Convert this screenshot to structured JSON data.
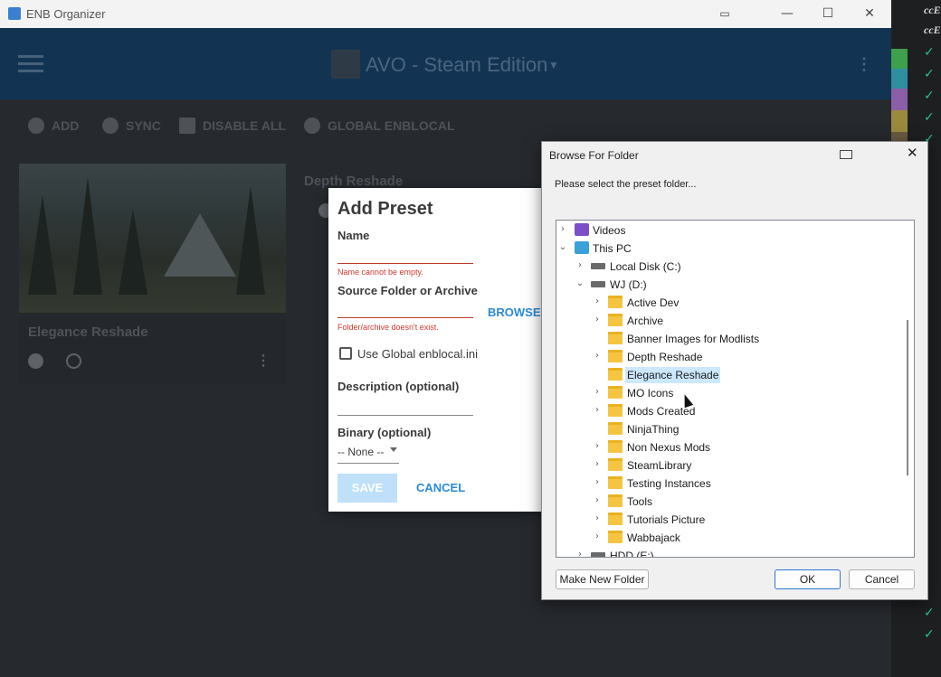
{
  "app": {
    "title": "ENB Organizer",
    "profile_title": "AVO - Steam Edition"
  },
  "toolbar": {
    "add": "ADD",
    "sync": "SYNC",
    "disable_all": "DISABLE ALL",
    "global_enblocal": "GLOBAL ENBLOCAL"
  },
  "presets": [
    {
      "name": "Elegance Reshade"
    },
    {
      "name": "Depth Reshade"
    }
  ],
  "add_preset": {
    "title": "Add Preset",
    "name_label": "Name",
    "name_error": "Name cannot be empty.",
    "source_label": "Source Folder or Archive",
    "source_error": "Folder/archive doesn't exist.",
    "browse": "BROWSE",
    "use_global_label": "Use Global enblocal.ini",
    "description_label": "Description (optional)",
    "binary_label": "Binary (optional)",
    "binary_value": "-- None --",
    "save": "SAVE",
    "cancel": "CANCEL"
  },
  "browse_dialog": {
    "title": "Browse For Folder",
    "prompt": "Please select the preset folder...",
    "tree": [
      {
        "label": "Videos",
        "icon": "video-folder-icon",
        "expanded": false
      },
      {
        "label": "This PC",
        "icon": "computer-icon",
        "expanded": true
      },
      {
        "label": "Local Disk (C:)",
        "icon": "drive-icon",
        "expanded": false
      },
      {
        "label": "WJ (D:)",
        "icon": "drive-icon",
        "expanded": true
      },
      {
        "label": "Active Dev",
        "icon": "folder-icon"
      },
      {
        "label": "Archive",
        "icon": "folder-icon"
      },
      {
        "label": "Banner Images for Modlists",
        "icon": "folder-icon"
      },
      {
        "label": "Depth Reshade",
        "icon": "folder-icon"
      },
      {
        "label": "Elegance Reshade",
        "icon": "folder-icon",
        "selected": true
      },
      {
        "label": "MO Icons",
        "icon": "folder-icon"
      },
      {
        "label": "Mods Created",
        "icon": "folder-icon"
      },
      {
        "label": "NinjaThing",
        "icon": "folder-icon"
      },
      {
        "label": "Non Nexus Mods",
        "icon": "folder-icon"
      },
      {
        "label": "SteamLibrary",
        "icon": "folder-icon"
      },
      {
        "label": "Testing Instances",
        "icon": "folder-icon"
      },
      {
        "label": "Tools",
        "icon": "folder-icon"
      },
      {
        "label": "Tutorials Picture",
        "icon": "folder-icon"
      },
      {
        "label": "Wabbajack",
        "icon": "folder-icon"
      },
      {
        "label": "HDD (E:)",
        "icon": "drive-icon"
      }
    ],
    "make_new_folder": "Make New Folder",
    "ok": "OK",
    "cancel": "Cancel"
  },
  "edge": {
    "text_1": "ccE",
    "text_2": "ccE"
  },
  "colors": {
    "header": "#123452",
    "accent": "#2b8ad8",
    "error": "#d23a2e",
    "selection": "#cce8ff"
  }
}
